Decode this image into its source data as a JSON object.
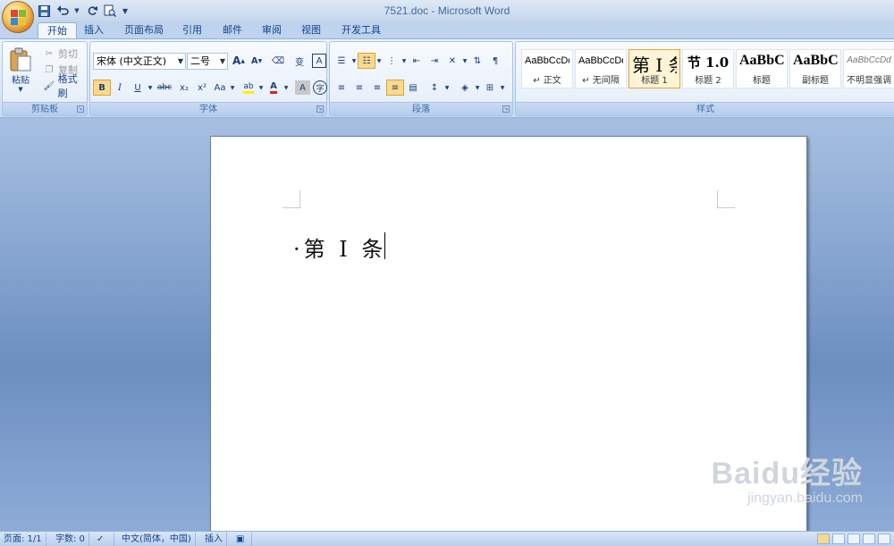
{
  "window": {
    "title": "7521.doc - Microsoft Word"
  },
  "qat": {
    "save": "save-icon",
    "undo": "undo-icon",
    "redo": "redo-icon",
    "preview": "print-preview-icon",
    "customize": "▼"
  },
  "tabs": [
    "开始",
    "插入",
    "页面布局",
    "引用",
    "邮件",
    "审阅",
    "视图",
    "开发工具"
  ],
  "clipboard": {
    "paste": "粘贴",
    "cut": "剪切",
    "copy": "复制",
    "format_painter": "格式刷",
    "label": "剪贴板"
  },
  "font": {
    "name": "宋体 (中文正文)",
    "size": "二号",
    "label": "字体",
    "bold": "B",
    "italic": "I",
    "underline": "U",
    "strike": "abc",
    "subscript": "x₂",
    "superscript": "x²",
    "case": "Aa",
    "grow": "A",
    "shrink": "A",
    "char_border": "A",
    "phonetic": "变",
    "char_shading": "A",
    "enclose": "字"
  },
  "paragraph": {
    "label": "段落"
  },
  "styles": {
    "label": "样式",
    "items": [
      {
        "sample": "AaBbCcDd",
        "name": "↵ 正文"
      },
      {
        "sample": "AaBbCcDd",
        "name": "↵ 无间隔"
      },
      {
        "sample": "第 I 条",
        "name": "标题 1"
      },
      {
        "sample": "节 1.0",
        "name": "标题 2"
      },
      {
        "sample": "AaBbC",
        "name": "标题"
      },
      {
        "sample": "AaBbC",
        "name": "副标题"
      },
      {
        "sample": "AaBbCcDd",
        "name": "不明显强调"
      }
    ]
  },
  "document": {
    "text": "·第 I 条"
  },
  "watermark": {
    "brand": "Baidu经验",
    "url": "jingyan.baidu.com"
  },
  "status": {
    "page": "页面: 1/1",
    "words": "字数: 0",
    "language": "中文(简体，中国)",
    "mode": "插入"
  },
  "colors": {
    "accent": "#15428b",
    "ribbon": "#dbe7f6",
    "doc_bg": "#6c8fc1"
  }
}
